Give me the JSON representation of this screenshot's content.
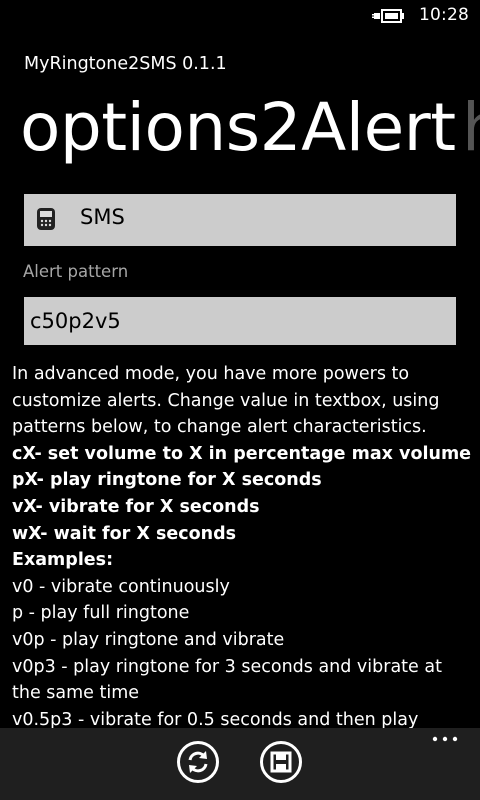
{
  "status": {
    "time": "10:28"
  },
  "app": {
    "title": "MyRingtone2SMS 0.1.1"
  },
  "pivot": {
    "active": "options2Alert",
    "next": "h"
  },
  "alert_type": {
    "value": "SMS",
    "icon": "sms-phone-icon"
  },
  "pattern": {
    "label": "Alert pattern",
    "value": "c50p2v5"
  },
  "help": {
    "intro": [
      "In advanced mode, you have more powers to",
      "customize alerts. Change value in textbox, using",
      "patterns below, to change alert characteristics."
    ],
    "rules": [
      "cX- set volume to X in percentage max volume",
      "pX- play ringtone for X seconds",
      "vX- vibrate for X seconds",
      "wX- wait for X seconds",
      "Examples:"
    ],
    "examples": [
      "v0 - vibrate continuously",
      "p - play full ringtone",
      "v0p - play ringtone and vibrate",
      "v0p3 - play ringtone for 3 seconds and vibrate at",
      "the same time",
      "v0.5p3 - vibrate for 0.5 seconds and then play"
    ]
  },
  "app_bar": {
    "buttons": [
      "refresh-icon",
      "save-icon"
    ],
    "more": "more-icon"
  }
}
